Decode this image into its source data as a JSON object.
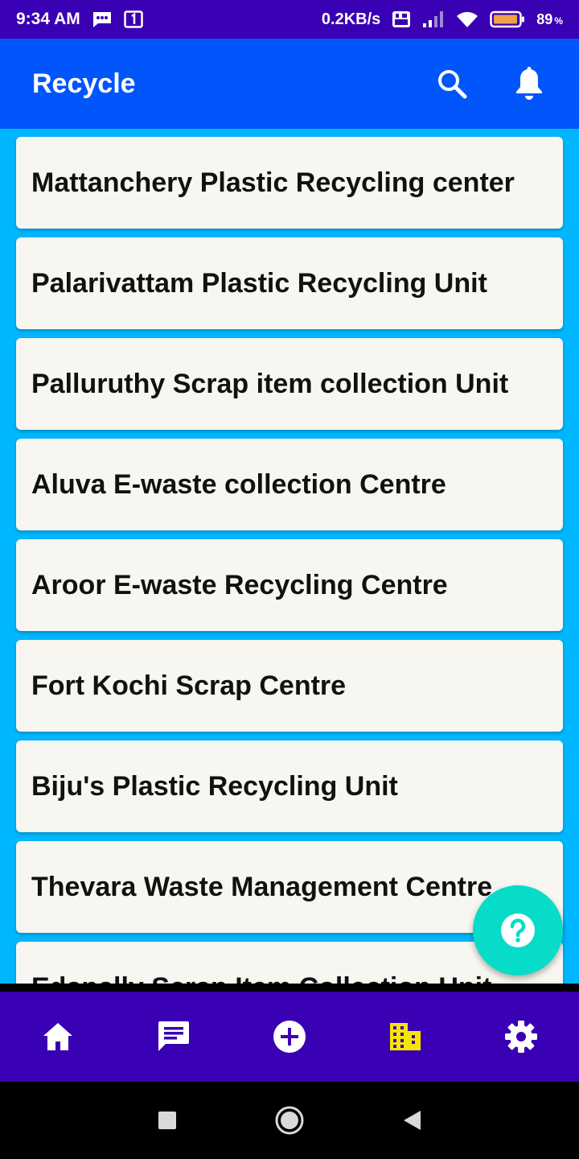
{
  "status_bar": {
    "time": "9:34 AM",
    "network_speed": "0.2KB/s",
    "battery_percent": "89",
    "battery_suffix": "%",
    "icons": [
      "message-icon",
      "sim-icon",
      "volte-icon",
      "signal-icon",
      "wifi-icon",
      "battery-icon"
    ]
  },
  "app_bar": {
    "title": "Recycle",
    "actions": [
      "search-icon",
      "bell-icon"
    ]
  },
  "list": {
    "items": [
      {
        "label": "Mattanchery Plastic Recycling center"
      },
      {
        "label": "Palarivattam Plastic Recycling Unit"
      },
      {
        "label": "Palluruthy Scrap item collection Unit"
      },
      {
        "label": "Aluva E-waste collection Centre"
      },
      {
        "label": "Aroor E-waste Recycling Centre"
      },
      {
        "label": "Fort Kochi Scrap Centre"
      },
      {
        "label": "Biju's Plastic Recycling Unit"
      },
      {
        "label": "Thevara Waste Management Centre"
      },
      {
        "label": "Edapally Scrap Item Collection Unit"
      }
    ]
  },
  "fab": {
    "icon": "help-icon"
  },
  "bottom_nav": {
    "items": [
      "home-icon",
      "chat-icon",
      "add-circle-icon",
      "building-icon",
      "settings-icon"
    ],
    "active_color": "#f5e600",
    "inactive_color": "#ffffff"
  },
  "colors": {
    "status_bar": "#3a00b3",
    "app_bar": "#0056fb",
    "list_background": "#00b7ff",
    "card": "#f7f6f0",
    "fab": "#06dcc8",
    "bottom_nav": "#3a00b3"
  },
  "system_nav": {
    "items": [
      "recent-apps-icon",
      "home-button-icon",
      "back-icon"
    ]
  }
}
